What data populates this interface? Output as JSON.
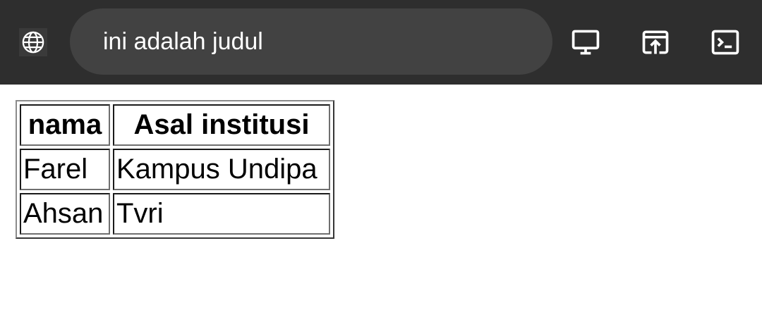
{
  "browser": {
    "address_text": "ini adalah judul",
    "icons": [
      "globe-icon",
      "desktop-icon",
      "open-in-app-icon",
      "terminal-icon"
    ],
    "toolbar_bg": "#2e2e2e",
    "urlbar_bg": "#424242"
  },
  "table": {
    "headers": [
      "nama",
      "Asal institusi"
    ],
    "rows": [
      [
        "Farel",
        "Kampus Undipa"
      ],
      [
        "Ahsan",
        "Tvri"
      ]
    ]
  }
}
